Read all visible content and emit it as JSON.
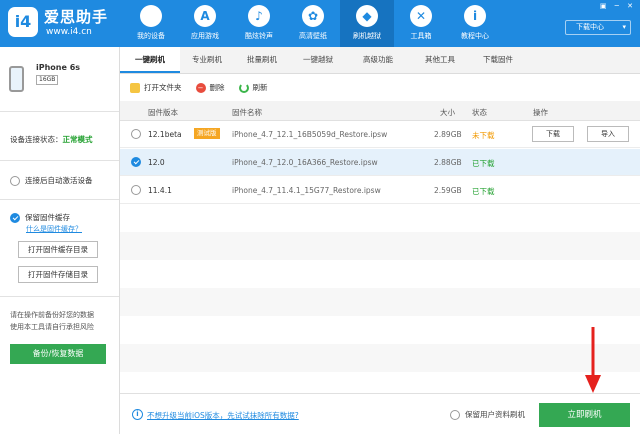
{
  "app": {
    "name": "爱思助手",
    "url": "www.i4.cn"
  },
  "nav": [
    {
      "label": "我的设备",
      "icon": "apple-icon",
      "glyph": ""
    },
    {
      "label": "应用游戏",
      "icon": "app-store-icon",
      "glyph": "A"
    },
    {
      "label": "酷炫铃声",
      "icon": "bell-icon",
      "glyph": "♪"
    },
    {
      "label": "高清壁纸",
      "icon": "wallpaper-icon",
      "glyph": "✿"
    },
    {
      "label": "刷机越狱",
      "icon": "dropbox-icon",
      "glyph": "◆"
    },
    {
      "label": "工具箱",
      "icon": "tools-icon",
      "glyph": "✕"
    },
    {
      "label": "教程中心",
      "icon": "info-icon",
      "glyph": "i"
    }
  ],
  "header": {
    "download_center": "下载中心"
  },
  "device": {
    "name": "iPhone 6s",
    "capacity": "16GB"
  },
  "sidebar": {
    "status_label": "设备连接状态：",
    "status_value": "正常模式",
    "auto_activate": "连接后自动激活设备",
    "keep_firmware": "保留固件缓存",
    "what_is_cache": "什么是固件缓存？",
    "open_cache_dir": "打开固件缓存目录",
    "open_store_dir": "打开固件存储目录",
    "warning": "请在操作前备份好您的数据\n使用本工具请自行承担风险",
    "backup_button": "备份/恢复数据"
  },
  "tabs": [
    "一键刷机",
    "专业刷机",
    "批量刷机",
    "一键越狱",
    "高级功能",
    "其他工具",
    "下载固件"
  ],
  "toolbar": {
    "open_folder": "打开文件夹",
    "delete": "删除",
    "refresh": "刷新"
  },
  "table": {
    "headers": {
      "version": "固件版本",
      "name": "固件名称",
      "size": "大小",
      "status": "状态",
      "action": "操作"
    },
    "rows": [
      {
        "version": "12.1beta",
        "badge": "测试版",
        "name": "iPhone_4.7_12.1_16B5059d_Restore.ipsw",
        "size": "2.89GB",
        "status": "未下载",
        "status_type": "orange",
        "download": "下载",
        "import": "导入",
        "selected": false
      },
      {
        "version": "12.0",
        "badge": "",
        "name": "iPhone_4.7_12.0_16A366_Restore.ipsw",
        "size": "2.88GB",
        "status": "已下载",
        "status_type": "green",
        "selected": true
      },
      {
        "version": "11.4.1",
        "badge": "",
        "name": "iPhone_4.7_11.4.1_15G77_Restore.ipsw",
        "size": "2.59GB",
        "status": "已下载",
        "status_type": "green",
        "selected": false
      }
    ]
  },
  "bottom": {
    "help_link": "不想升级当前iOS版本，先试试抹除所有数据?",
    "keep_user_data": "保留用户资料刷机",
    "flash_button": "立即刷机"
  },
  "colors": {
    "header": "#1f8ae0",
    "nav_active": "#1673c0",
    "green": "#34a853",
    "status_green": "#26a233",
    "status_orange": "#f29900",
    "arrow": "#e5211d"
  }
}
